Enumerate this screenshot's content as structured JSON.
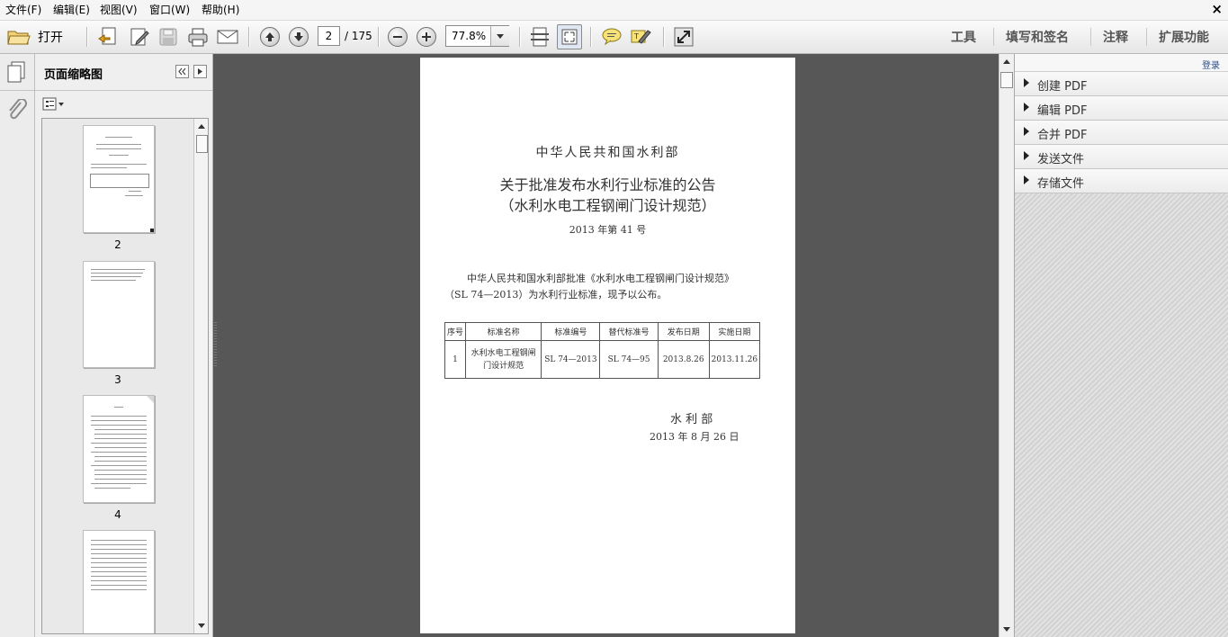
{
  "menubar": {
    "items": [
      "文件(F)",
      "编辑(E)",
      "视图(V)",
      "窗口(W)",
      "帮助(H)"
    ],
    "close": "×"
  },
  "toolbar": {
    "open_label": "打开",
    "page_current": "2",
    "page_total": "/ 175",
    "zoom": "77.8%",
    "right_tabs": [
      "工具",
      "填写和签名",
      "注释",
      "扩展功能"
    ]
  },
  "thumbnails": {
    "title": "页面缩略图",
    "pages": [
      "2",
      "3",
      "4"
    ]
  },
  "right_panel": {
    "login": "登录",
    "items": [
      "创建 PDF",
      "编辑 PDF",
      "合并 PDF",
      "发送文件",
      "存储文件"
    ]
  },
  "document": {
    "ministry": "中华人民共和国水利部",
    "title_line1": "关于批准发布水利行业标准的公告",
    "title_line2": "（水利水电工程钢闸门设计规范）",
    "number": "2013 年第 41 号",
    "body_line1": "中华人民共和国水利部批准《水利水电工程钢闸门设计规范》",
    "body_line2": "（SL 74—2013）为水利行业标准，现予以公布。",
    "table": {
      "headers": [
        "序号",
        "标准名称",
        "标准编号",
        "替代标准号",
        "发布日期",
        "实施日期"
      ],
      "row": [
        "1",
        "水利水电工程钢闸门设计规范",
        "SL 74—2013",
        "SL 74—95",
        "2013.8.26",
        "2013.11.26"
      ]
    },
    "signature": "水 利 部",
    "date": "2013 年 8 月 26 日"
  },
  "colors": {
    "doc_background": "#575757",
    "accent_tab": "#555555"
  }
}
